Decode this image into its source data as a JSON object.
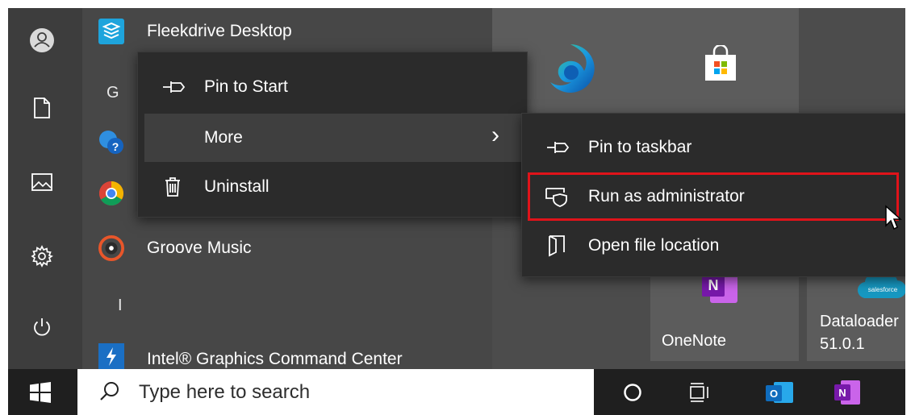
{
  "apps": {
    "fleekdrive": "Fleekdrive Desktop",
    "groove": "Groove Music",
    "intel": "Intel® Graphics Command Center"
  },
  "letters": {
    "g": "G",
    "i": "I"
  },
  "context_menu": {
    "pin_to_start": "Pin to Start",
    "more": "More",
    "more_chevron": "›",
    "uninstall": "Uninstall"
  },
  "submenu": {
    "pin_to_taskbar": "Pin to taskbar",
    "run_as_admin": "Run as administrator",
    "open_file_location": "Open file location"
  },
  "tiles": {
    "onenote": "OneNote",
    "dataloader_line1": "Dataloader",
    "dataloader_line2": "51.0.1",
    "salesforce_text": "salesforce"
  },
  "search": {
    "placeholder": "Type here to search"
  },
  "colors": {
    "highlight": "#e0131a",
    "onenote": "#7719aa",
    "outlook": "#0f6cbd",
    "fleekdrive": "#1ea4dc",
    "salesforce": "#1798c1"
  },
  "icons": {
    "user": "user-icon",
    "documents": "document-icon",
    "pictures": "picture-icon",
    "settings": "gear-icon",
    "power": "power-icon",
    "windows": "windows-logo-icon",
    "search": "search-icon",
    "cortana": "cortana-icon",
    "task_view": "task-view-icon"
  }
}
